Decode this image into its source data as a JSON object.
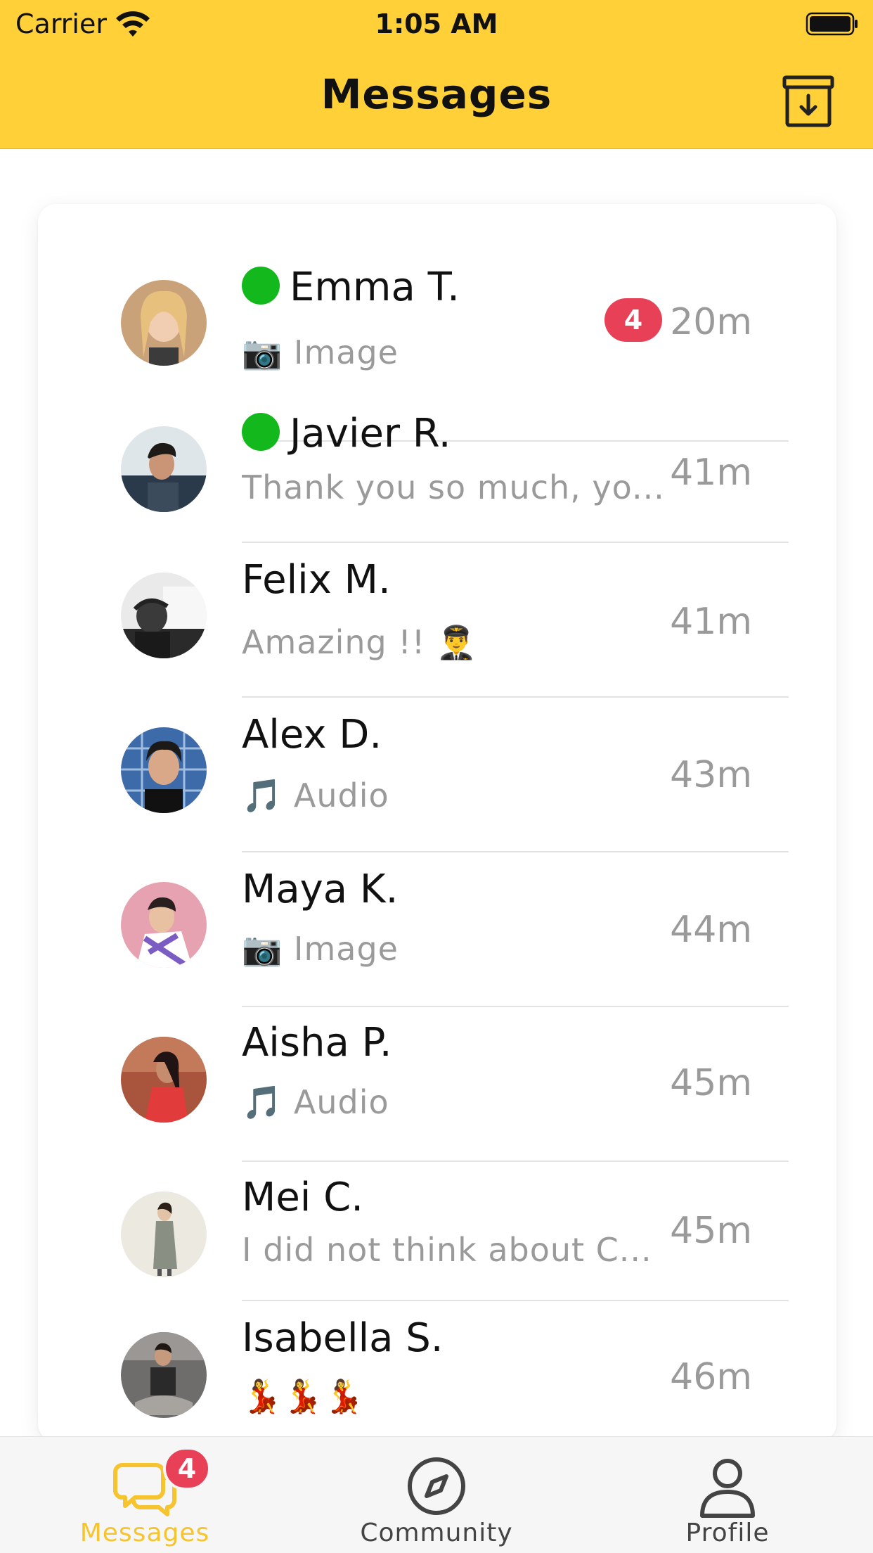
{
  "status_bar": {
    "carrier": "Carrier",
    "time": "1:05 AM"
  },
  "header": {
    "title": "Messages",
    "archive_icon": "archive-icon"
  },
  "conversations": [
    {
      "name": "Emma T.",
      "online": true,
      "preview": "📷 Image",
      "time": "20m",
      "unread": "4",
      "avatar_color": "#c9a27a"
    },
    {
      "name": "Javier R.",
      "online": true,
      "preview": "Thank you so much, yo...",
      "time": "41m",
      "unread": null,
      "avatar_color": "#7e6b5c"
    },
    {
      "name": "Felix M.",
      "online": false,
      "preview": "Amazing !! 👨‍✈️",
      "time": "41m",
      "unread": null,
      "avatar_color": "#4a4a4a"
    },
    {
      "name": "Alex D.",
      "online": false,
      "preview": "🎵 Audio",
      "time": "43m",
      "unread": null,
      "avatar_color": "#2d4a7a"
    },
    {
      "name": "Maya K.",
      "online": false,
      "preview": "📷 Image",
      "time": "44m",
      "unread": null,
      "avatar_color": "#d4879a"
    },
    {
      "name": "Aisha P.",
      "online": false,
      "preview": "🎵 Audio",
      "time": "45m",
      "unread": null,
      "avatar_color": "#a24632"
    },
    {
      "name": "Mei C.",
      "online": false,
      "preview": "I did not think about C...",
      "time": "45m",
      "unread": null,
      "avatar_color": "#e9e6df"
    },
    {
      "name": "Isabella S.",
      "online": false,
      "preview": "💃💃💃",
      "time": "46m",
      "unread": null,
      "avatar_color": "#6d6a68"
    }
  ],
  "tabbar": {
    "messages": {
      "label": "Messages",
      "badge": "4",
      "icon": "chat-bubbles-icon"
    },
    "community": {
      "label": "Community",
      "icon": "compass-icon"
    },
    "profile": {
      "label": "Profile",
      "icon": "person-icon"
    }
  },
  "colors": {
    "accent": "#ffd038",
    "online": "#13b81d",
    "badge": "#e84057",
    "active_tab": "#f5c42e",
    "inactive_tab": "#444444"
  }
}
